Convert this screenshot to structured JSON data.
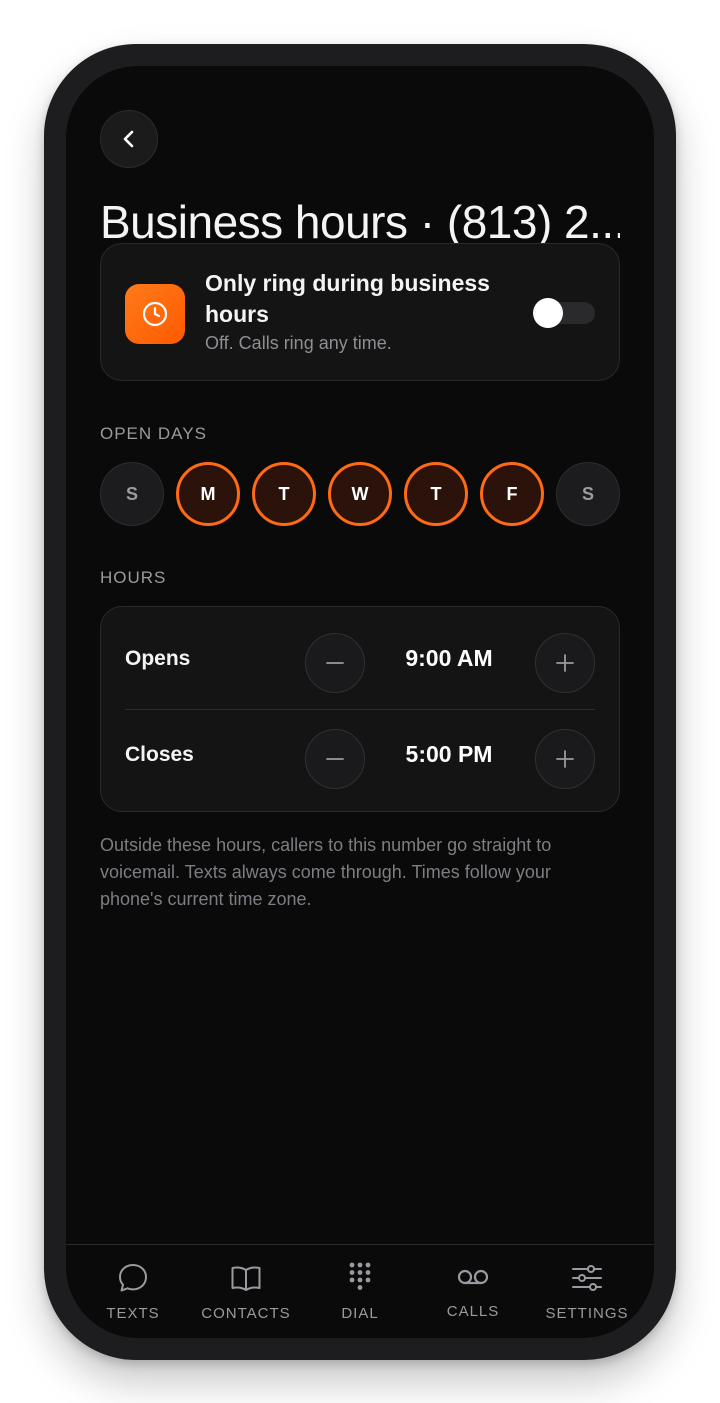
{
  "header": {
    "back_icon": "chevron-left-icon",
    "title": "Business hours · (813) 2..."
  },
  "ring_toggle": {
    "icon": "clock-icon",
    "icon_color": "#ff6a14",
    "title": "Only ring during business hours",
    "subtitle": "Off. Calls ring any time.",
    "enabled": false
  },
  "open_days": {
    "label": "OPEN DAYS",
    "days": [
      {
        "letter": "S",
        "selected": false
      },
      {
        "letter": "M",
        "selected": true
      },
      {
        "letter": "T",
        "selected": true
      },
      {
        "letter": "W",
        "selected": true
      },
      {
        "letter": "T",
        "selected": true
      },
      {
        "letter": "F",
        "selected": true
      },
      {
        "letter": "S",
        "selected": false
      }
    ]
  },
  "hours": {
    "label": "HOURS",
    "opens": {
      "label": "Opens",
      "time": "9:00 AM"
    },
    "closes": {
      "label": "Closes",
      "time": "5:00 PM"
    }
  },
  "note": "Outside these hours, callers to this number go straight to voicemail. Texts always come through. Times follow your phone's current time zone.",
  "tabs": [
    {
      "label": "TEXTS",
      "icon": "chat-bubble-icon"
    },
    {
      "label": "CONTACTS",
      "icon": "book-icon"
    },
    {
      "label": "DIAL",
      "icon": "dialpad-icon"
    },
    {
      "label": "CALLS",
      "icon": "voicemail-icon"
    },
    {
      "label": "SETTINGS",
      "icon": "sliders-icon"
    }
  ],
  "colors": {
    "accent": "#ff6a14",
    "background": "#0a0a0a",
    "card": "#141415"
  }
}
